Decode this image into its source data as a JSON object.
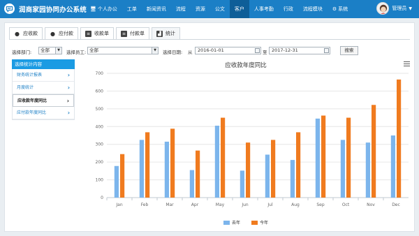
{
  "app": {
    "title": "润商家园协同办公系统"
  },
  "nav": {
    "items": [
      {
        "label": "个人办公",
        "glyph": "🖥",
        "active": false
      },
      {
        "label": "工单",
        "active": false
      },
      {
        "label": "新闻资讯",
        "active": false
      },
      {
        "label": "流程",
        "active": false
      },
      {
        "label": "资源",
        "active": false
      },
      {
        "label": "公文",
        "active": false
      },
      {
        "label": "客户",
        "active": true
      },
      {
        "label": "人事考勤",
        "active": false
      },
      {
        "label": "行政",
        "active": false
      },
      {
        "label": "流程模块",
        "active": false
      },
      {
        "label": "系统",
        "glyph": "⚙",
        "active": false
      }
    ]
  },
  "user": {
    "name": "管理员",
    "caret": "▼"
  },
  "tabs": [
    {
      "label": "应收款",
      "icon": "drop-icon",
      "active": false
    },
    {
      "label": "应付款",
      "icon": "drop-icon",
      "active": false
    },
    {
      "label": "收款单",
      "icon": "doc-icon",
      "active": false
    },
    {
      "label": "付款单",
      "icon": "doc-icon",
      "active": false
    },
    {
      "label": "统计",
      "icon": "chart-icon",
      "active": true
    }
  ],
  "filters": {
    "dept_label": "选择部门:",
    "dept_value": "全部",
    "staff_label": "选择员工:",
    "staff_value": "全部",
    "date_label": "选择日期:",
    "from_label": "从",
    "date_from": "2016-01-01",
    "to_label": "至",
    "date_to": "2017-12-31",
    "search_label": "搜索"
  },
  "sidemenu": {
    "header": "选择统计内容",
    "items": [
      {
        "label": "财务统计报表",
        "active": false
      },
      {
        "label": "月度统计",
        "active": false
      },
      {
        "label": "应收款年度同比",
        "active": true
      },
      {
        "label": "应付款年度同比",
        "active": false
      }
    ]
  },
  "chart_data": {
    "type": "bar",
    "title": "应收款年度同比",
    "categories": [
      "Jan",
      "Feb",
      "Mar",
      "Apr",
      "May",
      "Jun",
      "Jul",
      "Aug",
      "Sep",
      "Oct",
      "Nov",
      "Dec"
    ],
    "series": [
      {
        "name": "去年",
        "color": "#7cb5ec",
        "values": [
          178,
          325,
          315,
          155,
          405,
          152,
          242,
          212,
          445,
          325,
          310,
          350
        ]
      },
      {
        "name": "今年",
        "color": "#f07b1f",
        "values": [
          245,
          368,
          388,
          265,
          450,
          310,
          325,
          368,
          462,
          450,
          522,
          665
        ]
      }
    ],
    "ylim": [
      0,
      700
    ],
    "yticks": [
      0,
      100,
      200,
      300,
      400,
      500,
      600,
      700
    ],
    "grid": true,
    "legend": "bottom-center"
  }
}
